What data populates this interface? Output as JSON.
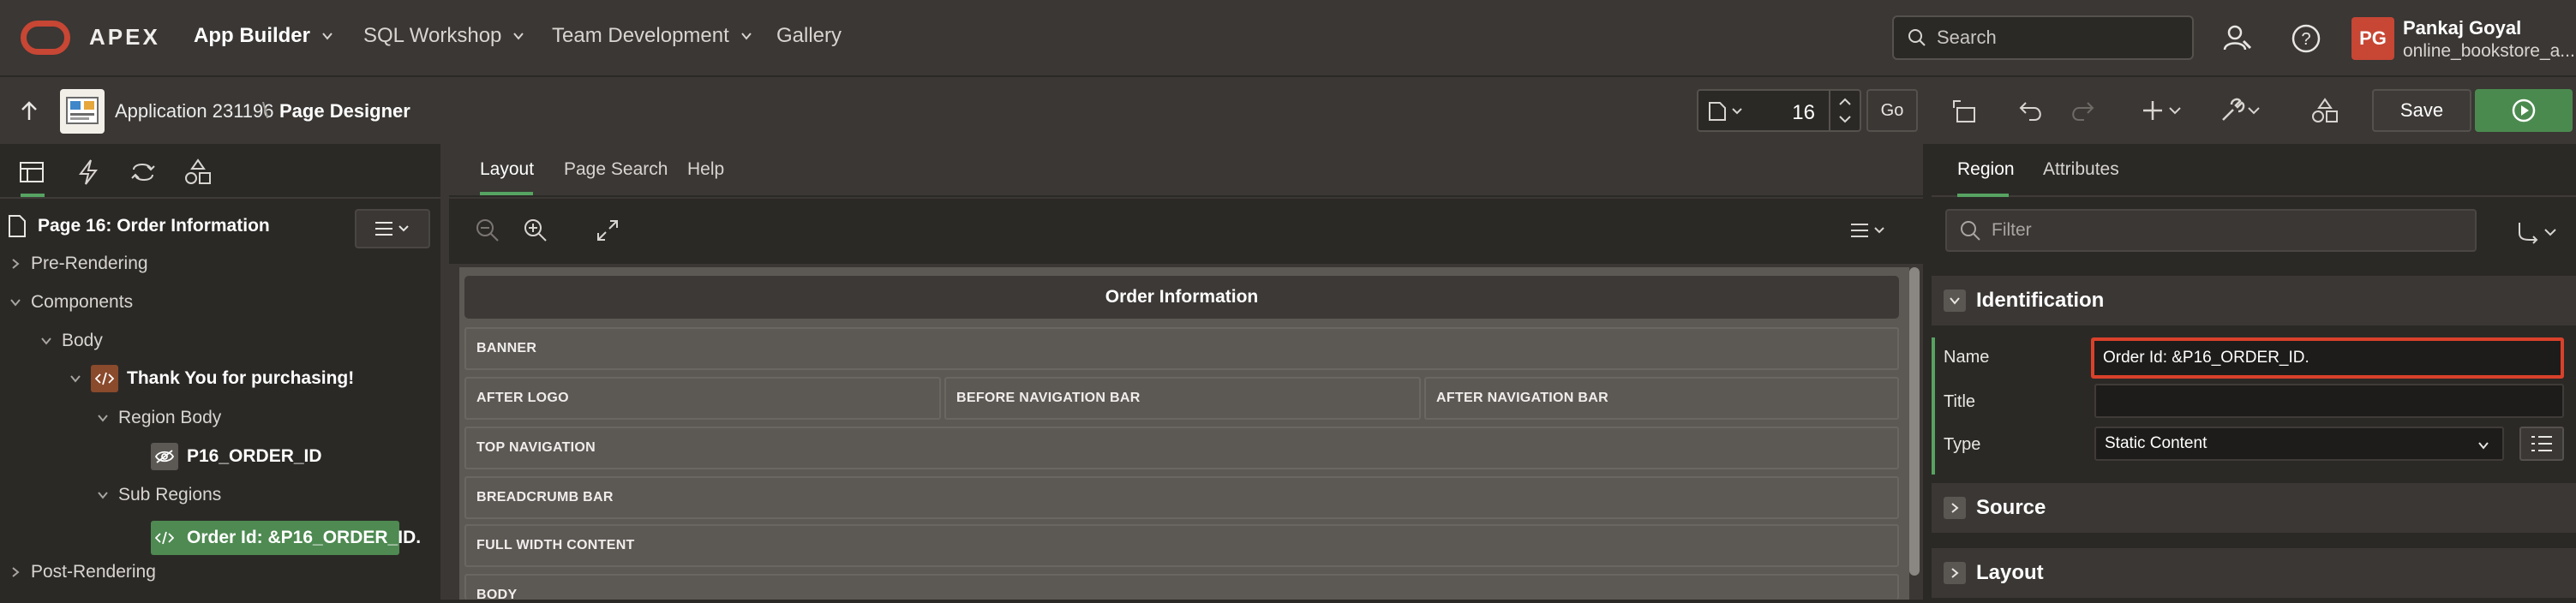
{
  "header": {
    "brand": "APEX",
    "nav": [
      {
        "label": "App Builder"
      },
      {
        "label": "SQL Workshop"
      },
      {
        "label": "Team Development"
      },
      {
        "label": "Gallery"
      }
    ],
    "search_placeholder": "Search",
    "user": {
      "initials": "PG",
      "name": "Pankaj Goyal",
      "workspace": "online_bookstore_a..."
    }
  },
  "toolbar": {
    "application": "Application 231196",
    "separator": "\\",
    "page_designer": "Page Designer",
    "page_number": "16",
    "go_label": "Go",
    "save_label": "Save"
  },
  "left_pane": {
    "page_title": "Page 16: Order Information",
    "tree": {
      "pre_rendering": "Pre-Rendering",
      "components": "Components",
      "body": "Body",
      "region": "Thank You for purchasing!",
      "region_body": "Region Body",
      "item": "P16_ORDER_ID",
      "sub_regions": "Sub Regions",
      "sub_region": "Order Id: &P16_ORDER_ID.",
      "post_rendering": "Post-Rendering"
    }
  },
  "center": {
    "tabs": [
      "Layout",
      "Page Search",
      "Help"
    ],
    "page_header": "Order Information",
    "slots": {
      "banner": "BANNER",
      "after_logo": "AFTER LOGO",
      "before_nav": "BEFORE NAVIGATION BAR",
      "after_nav": "AFTER NAVIGATION BAR",
      "top_nav": "TOP NAVIGATION",
      "breadcrumb": "BREADCRUMB BAR",
      "full_width": "FULL WIDTH CONTENT",
      "body": "BODY"
    }
  },
  "right_pane": {
    "tabs": [
      "Region",
      "Attributes"
    ],
    "filter_placeholder": "Filter",
    "sections": {
      "identification": "Identification",
      "source": "Source",
      "layout": "Layout"
    },
    "labels": {
      "name": "Name",
      "title": "Title",
      "type": "Type"
    },
    "values": {
      "name": "Order Id: &P16_ORDER_ID.",
      "title": "",
      "type": "Static Content"
    }
  },
  "colors": {
    "accent_green": "#56a362",
    "brand_red": "#c74634",
    "highlight_red": "#d9412b"
  }
}
